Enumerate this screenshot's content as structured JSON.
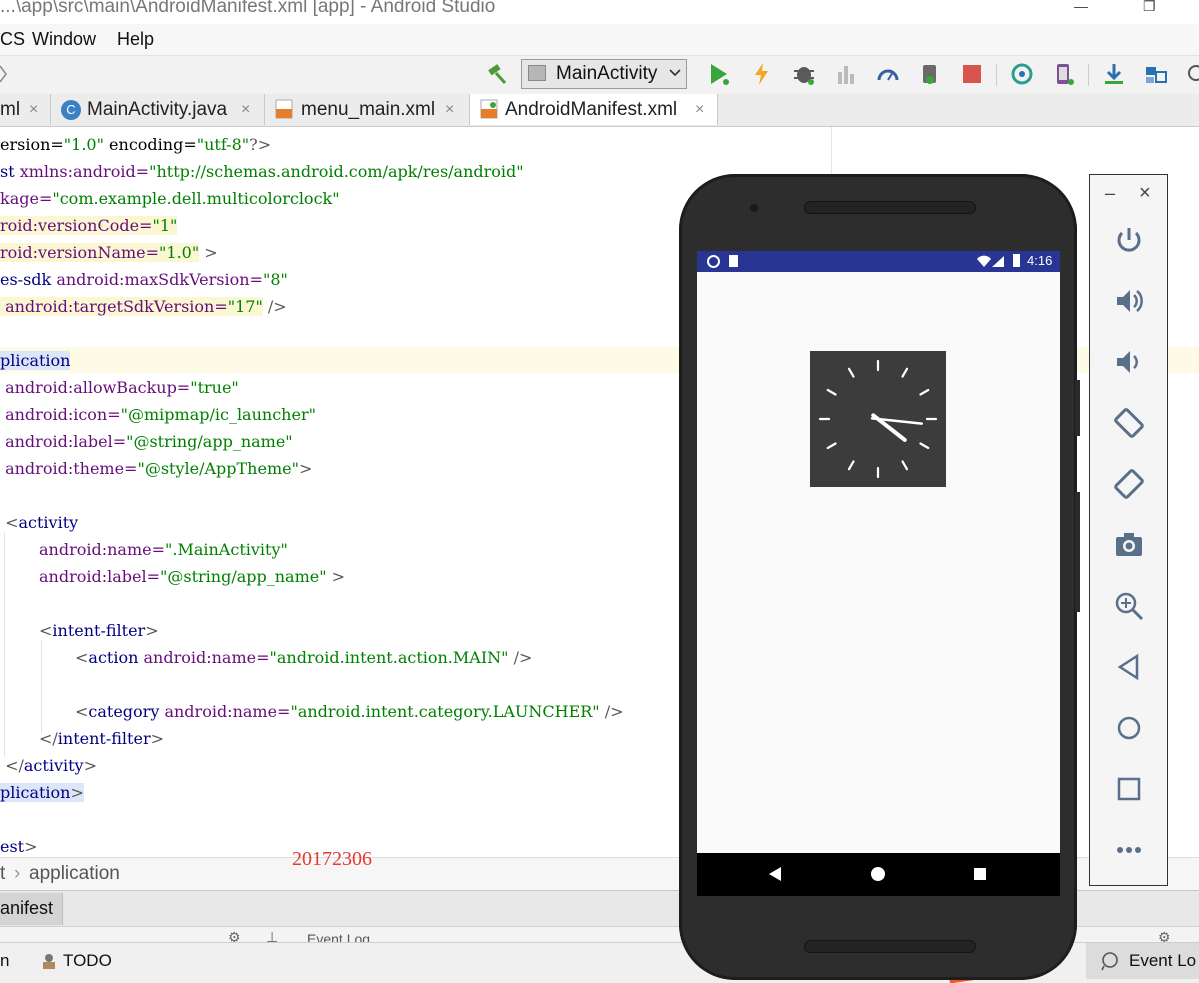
{
  "window": {
    "title": "...\\app\\src\\main\\AndroidManifest.xml [app] - Android Studio",
    "minimize_glyph": "—",
    "restore_glyph": "❐"
  },
  "menu": {
    "items": [
      "CS",
      "Window",
      "Help"
    ]
  },
  "toolbar": {
    "run_config": "MainActivity",
    "icons": [
      "hammer-icon",
      "run-icon",
      "apply-changes-icon",
      "debug-icon",
      "coverage-icon",
      "profile-icon",
      "attach-debugger-icon",
      "stop-icon",
      "sync-icon",
      "avd-manager-icon",
      "sdk-manager-icon",
      "project-structure-icon",
      "search-icon"
    ]
  },
  "tabs": [
    {
      "label": "ml",
      "close": "×"
    },
    {
      "label": "MainActivity.java",
      "close": "×",
      "icon": "C"
    },
    {
      "label": "menu_main.xml",
      "close": "×"
    },
    {
      "label": "AndroidManifest.xml",
      "close": "×"
    }
  ],
  "code": {
    "l1": {
      "a": "ersion=",
      "b": "\"1.0\"",
      "c": " encoding=",
      "d": "\"utf-8\"",
      "e": "?>"
    },
    "l2": {
      "a": "st ",
      "b": "xmlns:android=",
      "c": "\"http://schemas.android.com/apk/res/android\""
    },
    "l3": {
      "a": "kage=",
      "b": "\"com.example.dell.multicolorclock\""
    },
    "l4": {
      "a": "roid:versionCode=",
      "b": "\"1\""
    },
    "l5": {
      "a": "roid:versionName=",
      "b": "\"1.0\"",
      "c": " >"
    },
    "l6": {
      "a": "es-sdk ",
      "b": "android:maxSdkVersion=",
      "c": "\"8\""
    },
    "l7": {
      "a": " android:targetSdkVersion=",
      "b": "\"17\"",
      "c": " />"
    },
    "l8": {
      "a": "plication"
    },
    "l9": {
      "a": " android:allowBackup=",
      "b": "\"true\""
    },
    "l10": {
      "a": " android:icon=",
      "b": "\"@mipmap/ic_launcher\""
    },
    "l11": {
      "a": " android:label=",
      "b": "\"@string/app_name\""
    },
    "l12": {
      "a": " android:theme=",
      "b": "\"@style/AppTheme\"",
      "c": ">"
    },
    "l13": {
      "a": " <",
      "b": "activity"
    },
    "l14": {
      "a": "android:name=",
      "b": "\".MainActivity\""
    },
    "l15": {
      "a": "android:label=",
      "b": "\"@string/app_name\"",
      "c": " >"
    },
    "l16": {
      "a": "<",
      "b": "intent-filter",
      "c": ">"
    },
    "l17": {
      "a": "<",
      "b": "action ",
      "c": "android:name=",
      "d": "\"android.intent.action.MAIN\"",
      "e": " />"
    },
    "l18": {
      "a": "<",
      "b": "category ",
      "c": "android:name=",
      "d": "\"android.intent.category.LAUNCHER\"",
      "e": " />"
    },
    "l19": {
      "a": "</",
      "b": "intent-filter",
      "c": ">"
    },
    "l20": {
      "a": " </",
      "b": "activity",
      "c": ">"
    },
    "l21": {
      "a": "plication",
      "b": ">"
    },
    "l22": {
      "a": "est",
      "b": ">"
    }
  },
  "breadcrumb": {
    "left": "t",
    "sep": "›",
    "item": "application"
  },
  "watermark": "20172306",
  "bottom_tab": "anifest",
  "panels": {
    "event_log_header": "Event Log"
  },
  "statusbar": {
    "left": "n",
    "todo": "TODO",
    "event_log": "Event Lo"
  },
  "emulator": {
    "time": "4:16",
    "clock": {
      "hour": 4,
      "minute": 16
    },
    "side_controls": [
      "minimize-icon",
      "close-icon",
      "power-icon",
      "volume-up-icon",
      "volume-down-icon",
      "rotate-left-icon",
      "rotate-right-icon",
      "screenshot-icon",
      "zoom-icon",
      "back-icon",
      "home-icon",
      "overview-icon",
      "more-icon"
    ],
    "side_minimize_glyph": "–",
    "side_close_glyph": "×"
  }
}
